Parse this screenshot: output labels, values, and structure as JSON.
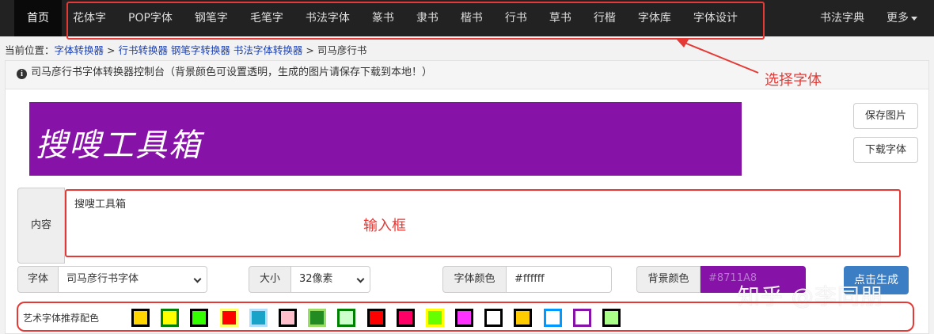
{
  "nav": {
    "home": "首页",
    "items": [
      "花体字",
      "POP字体",
      "钢笔字",
      "毛笔字",
      "书法字体",
      "篆书",
      "隶书",
      "楷书",
      "行书",
      "草书",
      "行楷",
      "字体库",
      "字体设计"
    ],
    "right": [
      "书法字典",
      "更多"
    ]
  },
  "annotation": {
    "nav_note": "选择字体",
    "input_note": "输入框"
  },
  "breadcrumb": {
    "prefix": "当前位置：",
    "link1": "字体转换器",
    "sep1": " > ",
    "link2": "行书转换器 钢笔字转换器 书法字体转换器",
    "sep2": " > ",
    "current": "司马彦行书"
  },
  "panel": {
    "info": "司马彦行书字体转换器控制台（背景颜色可设置透明，生成的图片请保存下载到本地！）",
    "preview_text": "搜嗖工具箱",
    "preview_bg": "#8712a8",
    "buttons": {
      "save": "保存图片",
      "download": "下载字体"
    },
    "content_label": "内容",
    "content_value": "搜嗖工具箱",
    "font_label": "字体",
    "font_value": "司马彦行书字体",
    "size_label": "大小",
    "size_value": "32像素",
    "color_label": "字体颜色",
    "color_value": "#ffffff",
    "bg_label": "背景颜色",
    "bg_value": "#8711A8",
    "generate": "点击生成",
    "swatch_label": "艺术字体推荐配色",
    "watermark": "知乎 @李同朋"
  },
  "swatches": [
    {
      "border": "#000000",
      "fill": "#ffd600"
    },
    {
      "border": "#008000",
      "fill": "#ffff00"
    },
    {
      "border": "#000000",
      "fill": "#33ff00"
    },
    {
      "border": "#ffff66",
      "fill": "#ff0000"
    },
    {
      "border": "#b0e0ff",
      "fill": "#1aa3c8"
    },
    {
      "border": "#000000",
      "fill": "#ffc0cb"
    },
    {
      "border": "#99dd66",
      "fill": "#228b22"
    },
    {
      "border": "#008000",
      "fill": "#ccffcc"
    },
    {
      "border": "#000000",
      "fill": "#ff0000"
    },
    {
      "border": "#000000",
      "fill": "#ff0066"
    },
    {
      "border": "#ffff00",
      "fill": "#66ff00"
    },
    {
      "border": "#000000",
      "fill": "#ff33ff"
    },
    {
      "border": "#000000",
      "fill": "#ffffff"
    },
    {
      "border": "#000000",
      "fill": "#ffcc00"
    },
    {
      "border": "#0099ff",
      "fill": "#ffffff"
    },
    {
      "border": "#8712a8",
      "fill": "#ffffff"
    },
    {
      "border": "#000000",
      "fill": "#aaff88"
    }
  ]
}
